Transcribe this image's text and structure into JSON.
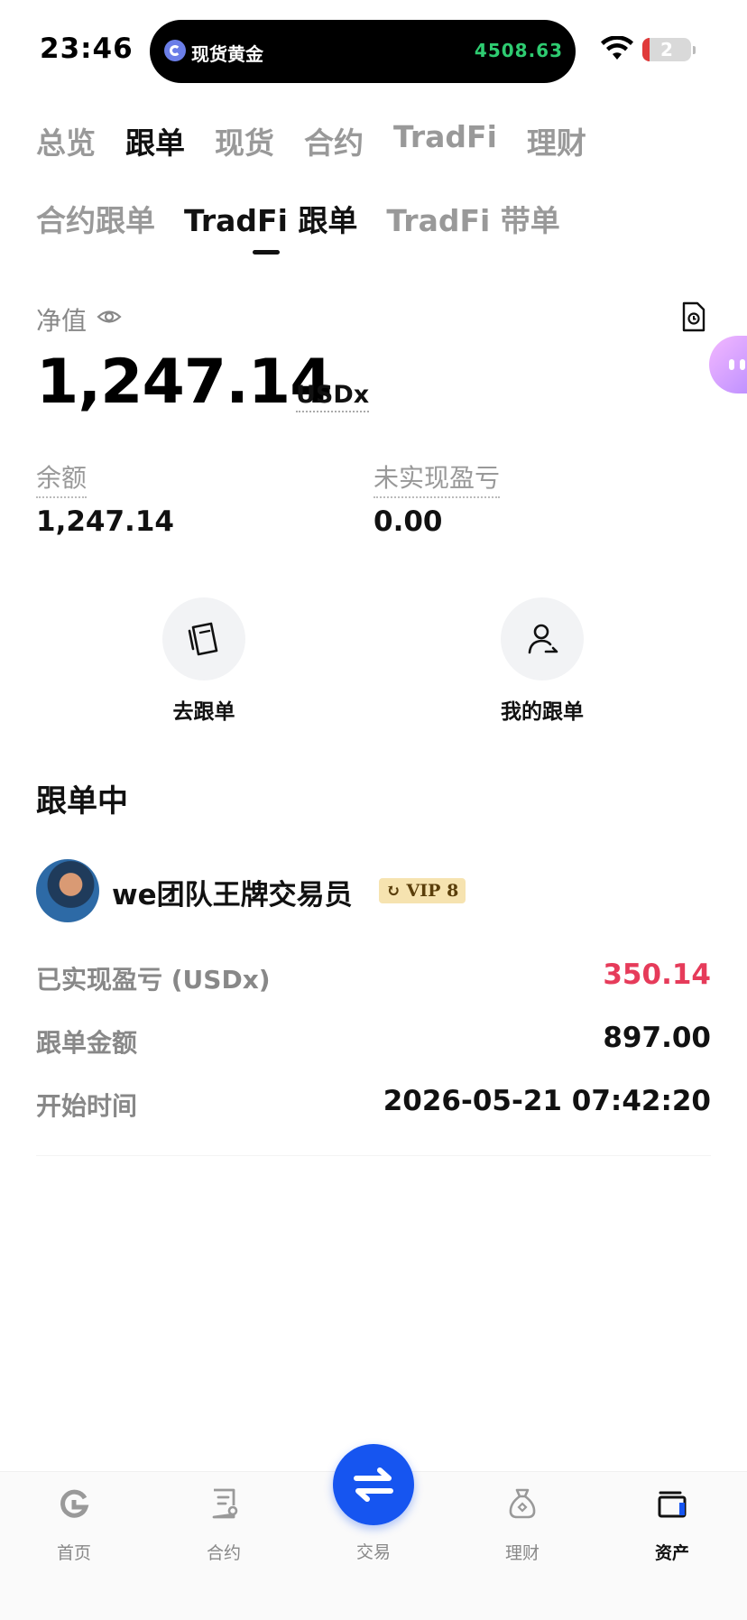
{
  "status_bar": {
    "time": "23:46",
    "island_label": "现货黄金",
    "island_price": "4508.63",
    "battery": "2"
  },
  "top_tabs": [
    "总览",
    "跟单",
    "现货",
    "合约",
    "TradFi",
    "理财"
  ],
  "top_tab_active": "跟单",
  "sub_tabs": [
    "合约跟单",
    "TradFi 跟单",
    "TradFi 带单"
  ],
  "sub_tab_active": "TradFi 跟单",
  "net": {
    "label": "净值",
    "value": "1,247.14",
    "unit": "USDx"
  },
  "stats": {
    "balance_label": "余额",
    "balance_value": "1,247.14",
    "unrealized_label": "未实现盈亏",
    "unrealized_value": "0.00"
  },
  "actions": {
    "go_copy": "去跟单",
    "my_copy": "我的跟单"
  },
  "section_title": "跟单中",
  "trader": {
    "name": "we团队王牌交易员",
    "vip": "VIP 8",
    "realized_label": "已实现盈亏 (USDx)",
    "realized_value": "350.14",
    "amount_label": "跟单金额",
    "amount_value": "897.00",
    "start_label": "开始时间",
    "start_value": "2026-05-21 07:42:20"
  },
  "bottom_nav": {
    "home": "首页",
    "contract": "合约",
    "trade": "交易",
    "finance": "理财",
    "assets": "资产"
  },
  "colors": {
    "accent_blue": "#1655f0",
    "pnl_red": "#e63b5a",
    "price_green": "#2ecc71"
  }
}
